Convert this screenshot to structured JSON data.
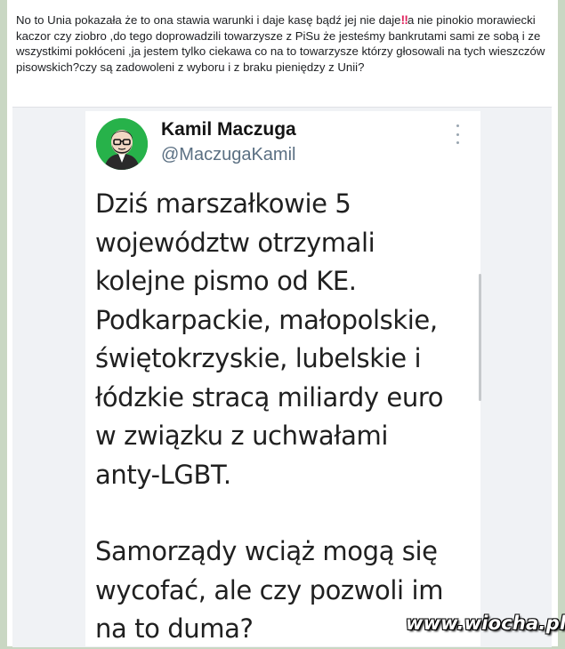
{
  "post": {
    "text_part1": "No to Unia pokazała że to ona stawia warunki i daje kasę bądź jej nie daje",
    "emoji": "‼",
    "text_part2": "a nie pinokio morawiecki kaczor czy ziobro ,do tego doprowadzili towarzysze z PiSu że jesteśmy bankrutami sami ze sobą i ze wszystkimi pokłóceni ,ja jestem tylko ciekawa co na to towarzysze którzy głosowali na tych wieszczów pisowskich?czy są zadowoleni z wyboru i z braku pieniędzy z Unii?"
  },
  "tweet": {
    "author_name": "Kamil Maczuga",
    "author_handle": "@MaczugaKamil",
    "body_lines": [
      "Dziś marszałkowie 5",
      "województw otrzymali",
      "kolejne pismo od KE.",
      "Podkarpackie, małopolskie,",
      "świętokrzyskie, lubelskie i",
      "łódzkie stracą miliardy euro",
      "w związku z uchwałami",
      "anty-LGBT.",
      "",
      "Samorządy wciąż mogą się",
      "wycofać, ale czy pozwoli im",
      "na to duma?"
    ]
  },
  "watermark": "www.wiocha.pl",
  "colors": {
    "avatar_bg": "#27b24a",
    "emoji": "#e0245e",
    "outer_bg": "#c9d7c3"
  },
  "icons": {
    "more": "vertical-dots-icon",
    "avatar": "avatar-illustration"
  }
}
